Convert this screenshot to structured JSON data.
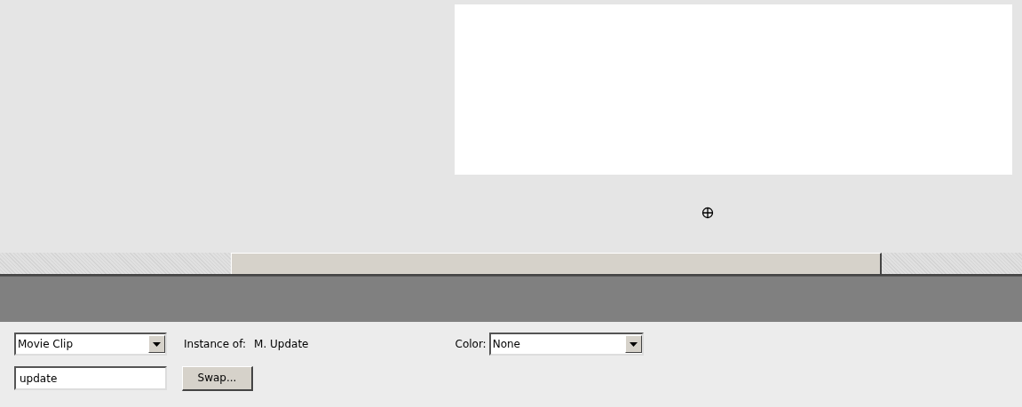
{
  "symbol_type": {
    "value": "Movie Clip"
  },
  "instance_of": {
    "label": "Instance of:",
    "value": "M. Update"
  },
  "color": {
    "label": "Color:",
    "value": "None"
  },
  "instance_name": {
    "value": "update"
  },
  "swap_button": {
    "label": "Swap..."
  }
}
